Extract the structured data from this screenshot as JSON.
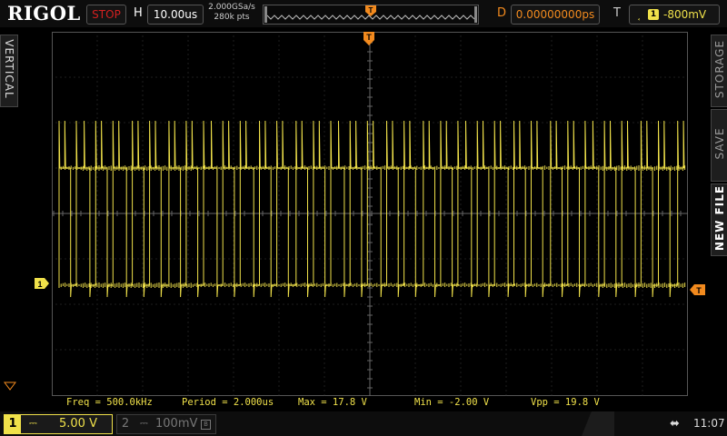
{
  "brand": "RIGOL",
  "status": {
    "run_state": "STOP",
    "run_state_color": "#d32020"
  },
  "horizontal": {
    "label": "H",
    "timebase": "10.00us",
    "sample_rate": "2.000GSa/s",
    "mem_depth": "280k pts"
  },
  "delay": {
    "label": "D",
    "value": "0.00000000ps"
  },
  "trigger": {
    "label": "T",
    "edge_icon": "rising-edge-icon",
    "source": "1",
    "level": "-800mV"
  },
  "side_tabs": {
    "left": "VERTICAL",
    "right": [
      "STORAGE",
      "SAVE",
      "NEW FILE"
    ]
  },
  "markers": {
    "channel1": "1",
    "trigger_time": "T",
    "trigger_level": "T"
  },
  "measurements": [
    {
      "label": "Freq = 500.0kHz"
    },
    {
      "label": "Period = 2.000us"
    },
    {
      "label": "Max = 17.8 V"
    },
    {
      "label": "Min = -2.00 V"
    },
    {
      "label": "Vpp = 19.8 V"
    }
  ],
  "channels": [
    {
      "number": "1",
      "coupling_icon": "dc-coupling-icon",
      "coupling": "⎓",
      "scale": "5.00 V",
      "active": true,
      "color": "#f0e14a"
    },
    {
      "number": "2",
      "coupling_icon": "dc-coupling-icon",
      "coupling": "⎓",
      "scale": "100mV",
      "bw_limit": "B",
      "active": false,
      "color": "#777777"
    }
  ],
  "status_bar": {
    "usb_icon": "usb-icon",
    "time": "11:07"
  },
  "colors": {
    "ch1": "#f0e14a",
    "trigger": "#f28a1e",
    "grid": "#3c3c3c"
  }
}
